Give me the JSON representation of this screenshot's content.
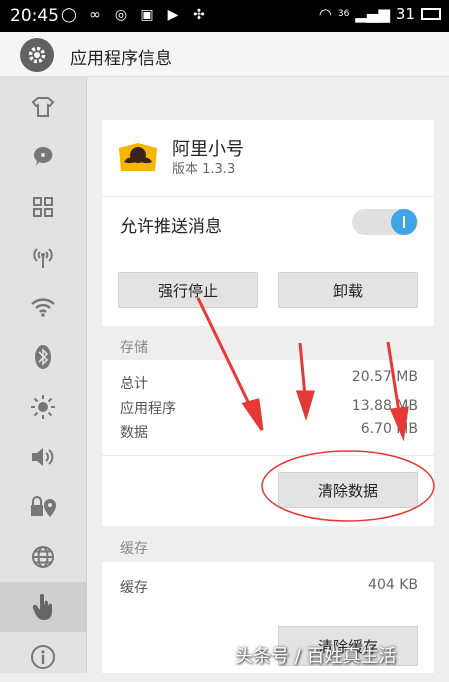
{
  "status_bar": {
    "time": "20:45",
    "signal_label": "36",
    "battery_label": "31"
  },
  "appbar": {
    "title": "应用程序信息",
    "icon": "gear-icon"
  },
  "sidebar": {
    "icons": [
      "shirt-icon",
      "chat-bubble-icon",
      "grid-icon",
      "antenna-icon",
      "wifi-icon",
      "bluetooth-icon",
      "brightness-icon",
      "volume-icon",
      "location-lock-icon",
      "globe-icon",
      "hand-icon",
      "info-icon"
    ],
    "active_index": 10
  },
  "app": {
    "name": "阿里小号",
    "version": "版本 1.3.3",
    "icon": "mustache-app-icon"
  },
  "notifications": {
    "label": "允许推送消息",
    "enabled": true
  },
  "buttons": {
    "force_stop": "强行停止",
    "uninstall": "卸载",
    "clear_data": "清除数据",
    "clear_cache": "清除缓存"
  },
  "storage": {
    "title": "存储",
    "rows": [
      {
        "label": "总计",
        "value": "20.57 MB"
      },
      {
        "label": "应用程序",
        "value": "13.88 MB"
      },
      {
        "label": "数据",
        "value": "6.70 MB"
      }
    ]
  },
  "cache": {
    "title": "缓存",
    "label": "缓存",
    "value": "404 KB"
  },
  "watermark": "头条号 / 百姓真生活",
  "annotation_colors": {
    "arrows": "#e53935",
    "ellipse": "#e53935"
  }
}
